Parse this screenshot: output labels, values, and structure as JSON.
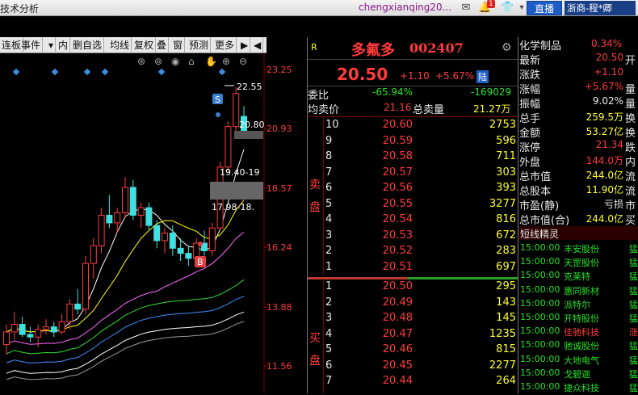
{
  "app": {
    "title": "技术分析",
    "user": "chengxianqing20...",
    "live_button": "直播",
    "account_label": "浙商-程*卿",
    "notif_badge": "1"
  },
  "toolbar": {
    "items": [
      "连板",
      "事件",
      "▾",
      "内",
      "删自选",
      "均线",
      "复权",
      "叠",
      "窗",
      "预测",
      "更多",
      "▶",
      "◀"
    ]
  },
  "chart": {
    "y_ticks": [
      "23.25",
      "20.93",
      "18.57",
      "16.24",
      "13.88",
      "11.56"
    ],
    "annotations": {
      "high": "22.55",
      "price_box": "20.80",
      "range1": "19.40-19",
      "range2": "17.98-18.",
      "sell_marker": "S",
      "buy_marker": "B"
    },
    "candles": [
      {
        "o": 12.4,
        "h": 13.2,
        "l": 12.0,
        "c": 12.9
      },
      {
        "o": 12.9,
        "h": 13.7,
        "l": 12.6,
        "c": 13.2
      },
      {
        "o": 13.2,
        "h": 13.5,
        "l": 12.7,
        "c": 12.8
      },
      {
        "o": 12.8,
        "h": 13.1,
        "l": 12.5,
        "c": 12.7
      },
      {
        "o": 12.7,
        "h": 13.2,
        "l": 12.3,
        "c": 13.0
      },
      {
        "o": 13.0,
        "h": 13.4,
        "l": 12.8,
        "c": 13.1
      },
      {
        "o": 13.1,
        "h": 13.3,
        "l": 12.7,
        "c": 12.9
      },
      {
        "o": 12.9,
        "h": 13.6,
        "l": 12.8,
        "c": 13.3
      },
      {
        "o": 13.3,
        "h": 14.2,
        "l": 13.0,
        "c": 14.0
      },
      {
        "o": 14.0,
        "h": 14.6,
        "l": 13.6,
        "c": 13.8
      },
      {
        "o": 13.8,
        "h": 15.9,
        "l": 13.6,
        "c": 15.6
      },
      {
        "o": 15.6,
        "h": 16.6,
        "l": 15.0,
        "c": 16.3
      },
      {
        "o": 16.3,
        "h": 17.8,
        "l": 16.0,
        "c": 17.5
      },
      {
        "o": 17.5,
        "h": 18.3,
        "l": 17.0,
        "c": 17.2
      },
      {
        "o": 17.2,
        "h": 17.8,
        "l": 16.8,
        "c": 17.6
      },
      {
        "o": 17.6,
        "h": 19.0,
        "l": 17.4,
        "c": 18.6
      },
      {
        "o": 18.6,
        "h": 18.9,
        "l": 17.3,
        "c": 17.5
      },
      {
        "o": 17.5,
        "h": 18.0,
        "l": 17.0,
        "c": 17.8
      },
      {
        "o": 17.8,
        "h": 18.0,
        "l": 16.9,
        "c": 17.1
      },
      {
        "o": 17.1,
        "h": 17.3,
        "l": 16.2,
        "c": 16.5
      },
      {
        "o": 16.5,
        "h": 17.0,
        "l": 16.0,
        "c": 16.8
      },
      {
        "o": 16.8,
        "h": 17.1,
        "l": 15.9,
        "c": 16.2
      },
      {
        "o": 16.2,
        "h": 16.6,
        "l": 15.7,
        "c": 16.0
      },
      {
        "o": 16.0,
        "h": 16.3,
        "l": 15.5,
        "c": 15.8
      },
      {
        "o": 15.8,
        "h": 16.6,
        "l": 15.5,
        "c": 16.4
      },
      {
        "o": 16.4,
        "h": 16.9,
        "l": 15.9,
        "c": 16.1
      },
      {
        "o": 16.1,
        "h": 17.2,
        "l": 15.9,
        "c": 17.0
      },
      {
        "o": 17.0,
        "h": 19.6,
        "l": 16.9,
        "c": 19.4
      },
      {
        "o": 19.4,
        "h": 21.2,
        "l": 19.2,
        "c": 21.0
      },
      {
        "o": 21.0,
        "h": 22.55,
        "l": 20.8,
        "c": 22.3
      },
      {
        "o": 21.4,
        "h": 21.8,
        "l": 20.6,
        "c": 20.8
      }
    ]
  },
  "quote": {
    "flag": "R",
    "name": "多氟多",
    "code": "002407",
    "price": "20.50",
    "change": "+1.10",
    "change_pct": "+5.67%",
    "market_tag": "陆",
    "webi_label": "委比",
    "webi_pct": "-65.94%",
    "webi_val": "-169029",
    "avg_label": "均卖价",
    "avg_val": "21.16",
    "total_label": "总卖量",
    "total_val": "21.27万",
    "sell_label": "卖盘",
    "buy_label": "买盘",
    "sells": [
      {
        "lvl": "10",
        "price": "20.60",
        "vol": "2753"
      },
      {
        "lvl": "9",
        "price": "20.59",
        "vol": "596"
      },
      {
        "lvl": "8",
        "price": "20.58",
        "vol": "711"
      },
      {
        "lvl": "7",
        "price": "20.57",
        "vol": "303"
      },
      {
        "lvl": "6",
        "price": "20.56",
        "vol": "393"
      },
      {
        "lvl": "5",
        "price": "20.55",
        "vol": "3277"
      },
      {
        "lvl": "4",
        "price": "20.54",
        "vol": "816"
      },
      {
        "lvl": "3",
        "price": "20.53",
        "vol": "672"
      },
      {
        "lvl": "2",
        "price": "20.52",
        "vol": "283"
      },
      {
        "lvl": "1",
        "price": "20.51",
        "vol": "697"
      }
    ],
    "buys": [
      {
        "lvl": "1",
        "price": "20.50",
        "vol": "295"
      },
      {
        "lvl": "2",
        "price": "20.49",
        "vol": "143"
      },
      {
        "lvl": "3",
        "price": "20.48",
        "vol": "145"
      },
      {
        "lvl": "4",
        "price": "20.47",
        "vol": "1235"
      },
      {
        "lvl": "5",
        "price": "20.46",
        "vol": "815"
      },
      {
        "lvl": "6",
        "price": "20.45",
        "vol": "2277"
      },
      {
        "lvl": "7",
        "price": "20.44",
        "vol": "264"
      }
    ]
  },
  "stats": {
    "sector": "化学制品",
    "sector_pct": "0.34%",
    "rows": [
      {
        "label": "最新",
        "value": "20.50",
        "color": "red",
        "tail": "开"
      },
      {
        "label": "涨跌",
        "value": "+1.10",
        "color": "red",
        "tail": ""
      },
      {
        "label": "涨幅",
        "value": "+5.67%",
        "color": "red",
        "tail": "量"
      },
      {
        "label": "振幅",
        "value": "9.02%",
        "color": "white",
        "tail": "量"
      },
      {
        "label": "总手",
        "value": "259.5万",
        "color": "yellow",
        "tail": "换"
      },
      {
        "label": "金额",
        "value": "53.27亿",
        "color": "yellow",
        "tail": "换"
      },
      {
        "label": "涨停",
        "value": "21.34",
        "color": "red",
        "tail": "跌"
      },
      {
        "label": "外盘",
        "value": "144.0万",
        "color": "red",
        "tail": "内"
      },
      {
        "label": "总市值",
        "value": "244.0亿",
        "color": "yellow",
        "tail": "流"
      },
      {
        "label": "总股本",
        "value": "11.90亿",
        "color": "yellow",
        "tail": "流"
      },
      {
        "label": "市盈(静)",
        "value": "亏损",
        "color": "white",
        "tail": "市"
      },
      {
        "label": "总市值(合)",
        "value": "244.0亿",
        "color": "yellow",
        "tail": "买"
      }
    ],
    "wizard_title": "短线精灵",
    "events": [
      {
        "time": "15:00:00",
        "name": "丰安股份",
        "color": "green",
        "tag": "猛"
      },
      {
        "time": "15:00:00",
        "name": "天罡股份",
        "color": "green",
        "tag": "猛"
      },
      {
        "time": "15:00:00",
        "name": "克莱特",
        "color": "green",
        "tag": "猛"
      },
      {
        "time": "15:00:00",
        "name": "惠同新材",
        "color": "green",
        "tag": "猛"
      },
      {
        "time": "15:00:00",
        "name": "派特尔",
        "color": "green",
        "tag": "猛"
      },
      {
        "time": "15:00:00",
        "name": "开特股份",
        "color": "green",
        "tag": "猛"
      },
      {
        "time": "15:00:00",
        "name": "佳驰科技",
        "color": "red",
        "tag": "涨"
      },
      {
        "time": "15:00:00",
        "name": "驰诚股份",
        "color": "green",
        "tag": "猛"
      },
      {
        "time": "15:00:00",
        "name": "大地电气",
        "color": "green",
        "tag": "猛"
      },
      {
        "time": "15:00:00",
        "name": "戈碧迦",
        "color": "green",
        "tag": "猛"
      },
      {
        "time": "15:00:00",
        "name": "捷众科技",
        "color": "green",
        "tag": "猛"
      }
    ]
  }
}
